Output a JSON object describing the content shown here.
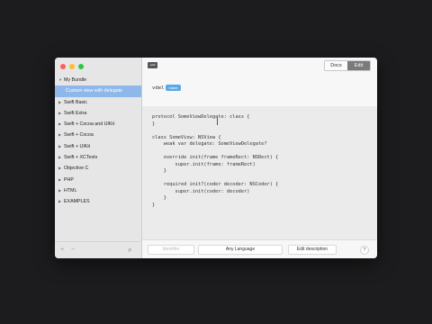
{
  "sidebar": {
    "items": [
      {
        "label": "My Bundle",
        "arrow": "▼",
        "level": 0,
        "selected": false
      },
      {
        "label": "Custom view with delegate",
        "arrow": "",
        "level": 1,
        "selected": true
      },
      {
        "label": "Swift Basic",
        "arrow": "▶",
        "level": 0,
        "selected": false
      },
      {
        "label": "Swift Extra",
        "arrow": "▶",
        "level": 0,
        "selected": false
      },
      {
        "label": "Swift + Cocoa and UIKit",
        "arrow": "▶",
        "level": 0,
        "selected": false
      },
      {
        "label": "Swift + Cocoa",
        "arrow": "▶",
        "level": 0,
        "selected": false
      },
      {
        "label": "Swift + UIKit",
        "arrow": "▶",
        "level": 0,
        "selected": false
      },
      {
        "label": "Swift + XCTests",
        "arrow": "▶",
        "level": 0,
        "selected": false
      },
      {
        "label": "Objective C",
        "arrow": "▶",
        "level": 0,
        "selected": false
      },
      {
        "label": "PHP",
        "arrow": "▶",
        "level": 0,
        "selected": false
      },
      {
        "label": "HTML",
        "arrow": "▶",
        "level": 0,
        "selected": false
      },
      {
        "label": "EXAMPLES",
        "arrow": "▶",
        "level": 0,
        "selected": false
      }
    ],
    "add_label": "+",
    "remove_label": "−",
    "search_icon": "⌕"
  },
  "header": {
    "badge_label": "swift",
    "docs_label": "Docs",
    "edit_label": "Edit",
    "abbreviation": "vdel",
    "token_label": "name"
  },
  "code": {
    "text": "protocol SomeViewDelegate: class {\n}\n\nclass SomeView: NSView {\n    weak var delegate: SomeViewDelegate?\n\n    override init(frame frameRect: NSRect) {\n        super.init(frame: frameRect)\n    }\n\n    required init?(coder decoder: NSCoder) {\n        super.init(coder: decoder)\n    }\n}"
  },
  "footer": {
    "identifier_placeholder": "Identifier",
    "language_label": "Any Language",
    "description_label": "Edit description",
    "help_label": "?"
  },
  "colors": {
    "selection": "#8fb8ea",
    "token": "#5aa9e6",
    "close": "#fe5f57",
    "minimize": "#febc2e",
    "maximize": "#28c840"
  }
}
